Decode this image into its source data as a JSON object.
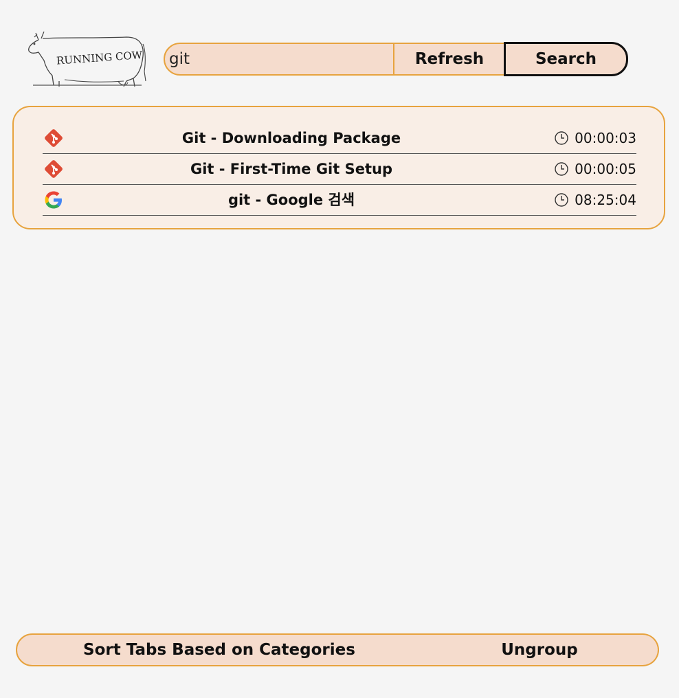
{
  "header": {
    "logo_text": "RUNNING COW",
    "search": {
      "value": "git"
    },
    "refresh_label": "Refresh",
    "search_label": "Search"
  },
  "results": [
    {
      "icon": "git-icon",
      "title": "Git - Downloading Package",
      "time": "00:00:03"
    },
    {
      "icon": "git-icon",
      "title": "Git - First-Time Git Setup",
      "time": "00:00:05"
    },
    {
      "icon": "google-icon",
      "title": "git - Google 검색",
      "time": "08:25:04"
    }
  ],
  "footer": {
    "sort_label": "Sort Tabs Based on Categories",
    "ungroup_label": "Ungroup"
  },
  "colors": {
    "accent_border": "#e7a33e",
    "button_fill": "#f5dccd",
    "panel_fill": "#f9eee6",
    "git_orange": "#de4c36"
  }
}
